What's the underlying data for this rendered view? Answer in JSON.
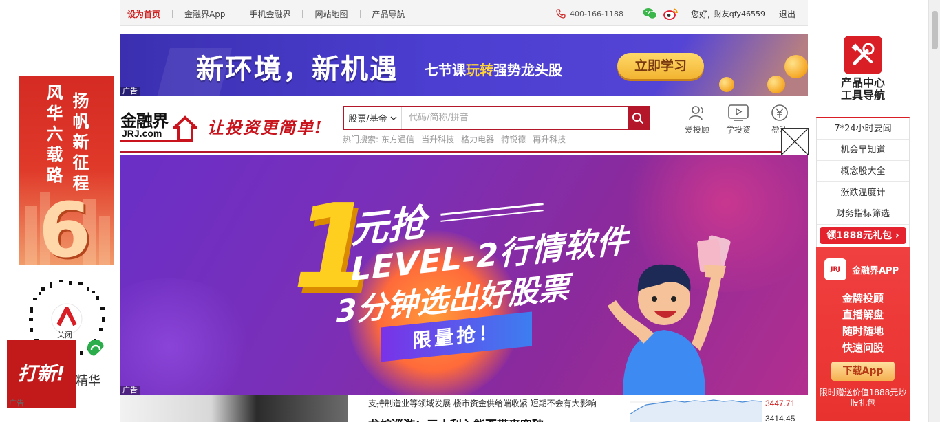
{
  "topbar": {
    "links": [
      "设为首页",
      "金融界App",
      "手机金融界",
      "网站地图",
      "产品导航"
    ],
    "phone": "400-166-1188",
    "welcome": "您好,",
    "user": "财友qfy46559",
    "logout": "退出"
  },
  "top_ad": {
    "headline": "新环境，新机遇",
    "subline_pre": "七节课",
    "subline_highlight": "玩转",
    "subline_post": "强势龙头股",
    "button": "立即学习",
    "tag": "广告"
  },
  "header": {
    "logo_cn": "金融界",
    "logo_en": "JRJ.com",
    "slogan": "让投资更简单!",
    "search_type": "股票/基金",
    "search_placeholder": "代码/简称/拼音",
    "hot_label": "热门搜索:",
    "hot_terms": [
      "东方通信",
      "当升科技",
      "格力电器",
      "特锐德",
      "再升科技"
    ],
    "nav": [
      {
        "label": "爱投顾",
        "icon": "advisor-icon"
      },
      {
        "label": "学投资",
        "icon": "video-icon"
      },
      {
        "label": "盈利",
        "icon": "yuan-icon"
      }
    ]
  },
  "banner": {
    "big_number": "1",
    "line1": "元抢",
    "line2": "LEVEL-2行情软件",
    "line3": "3分钟选出好股票",
    "cta": "限量抢！",
    "tag": "广告"
  },
  "news": {
    "line1": "支持制造业等领域发展  楼市资金供给端收紧  短期不会有大影响",
    "line2": "龙蛇巡游：三十利入能否带来突破",
    "prices": [
      "3447.71",
      "3414.45"
    ]
  },
  "left_side": {
    "ad_words": [
      "风华六载路",
      "扬帆新征程"
    ],
    "number": "6",
    "close_label": "关闭",
    "jinghua": "精华",
    "daxin": "打新!",
    "tag": "广告"
  },
  "right_side": {
    "title_line1": "产品中心",
    "title_line2": "工具导航",
    "items": [
      "7*24小时要闻",
      "机会早知道",
      "概念股大全",
      "涨跌温度计",
      "财务指标筛选"
    ],
    "gift": "领1888元礼包 ›",
    "app_brand": "金融界APP",
    "features": [
      "金牌投顾",
      "直播解盘",
      "随时随地",
      "快速问股"
    ],
    "download": "下载App",
    "promo": "限时赠送价值1888元炒股礼包"
  },
  "colors": {
    "brand_red": "#b5172a",
    "link_red": "#d01f1f",
    "price_red": "#d01f1f",
    "price_dark": "#333333"
  }
}
